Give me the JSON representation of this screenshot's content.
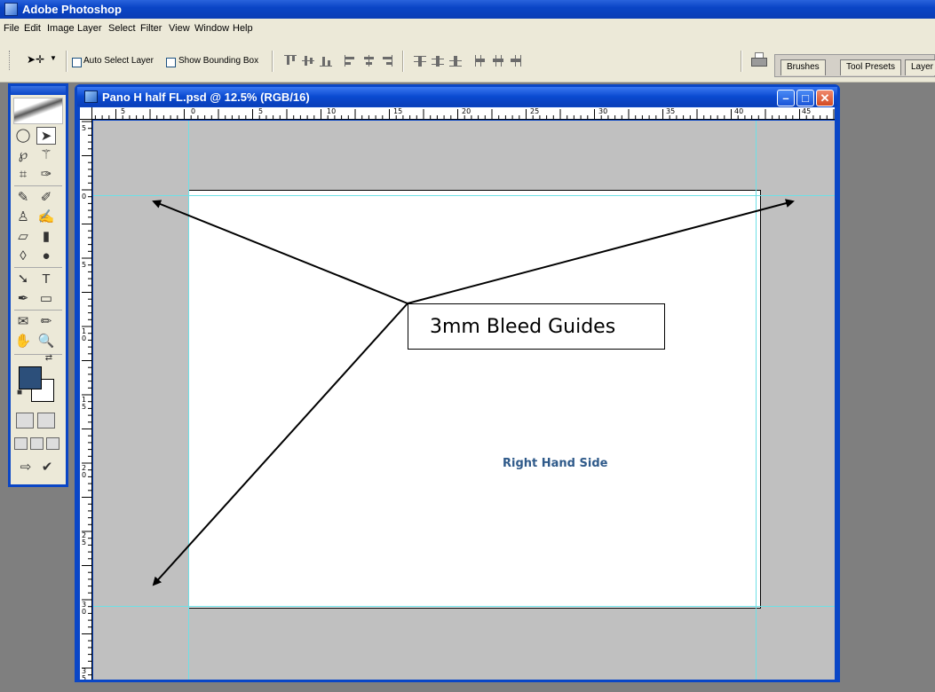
{
  "app": {
    "title": "Adobe Photoshop"
  },
  "menu": [
    "File",
    "Edit",
    "Image",
    "Layer",
    "Select",
    "Filter",
    "View",
    "Window",
    "Help"
  ],
  "options": {
    "auto_select_label": "Auto Select Layer",
    "auto_select_checked": false,
    "bounding_box_label": "Show Bounding Box",
    "bounding_box_checked": false
  },
  "palette_well": {
    "tabs": [
      "Brushes",
      "Tool Presets",
      "Layer"
    ]
  },
  "toolbox": {
    "colors": {
      "foreground": "#2c4f7a",
      "background": "#ffffff"
    }
  },
  "document": {
    "title": "Pano H half FL.psd @ 12.5% (RGB/16)",
    "zoom": "12.5%",
    "ruler_h_labels": [
      "5",
      "0",
      "5",
      "10",
      "15",
      "20",
      "25",
      "30",
      "35",
      "40",
      "45"
    ],
    "ruler_v_labels": [
      "5",
      "0",
      "5",
      "10",
      "15",
      "20",
      "25",
      "30",
      "35"
    ],
    "canvas_text": "Right Hand Side",
    "guide_color": "#6ee0e6"
  },
  "annotation": {
    "label": "3mm Bleed Guides"
  }
}
